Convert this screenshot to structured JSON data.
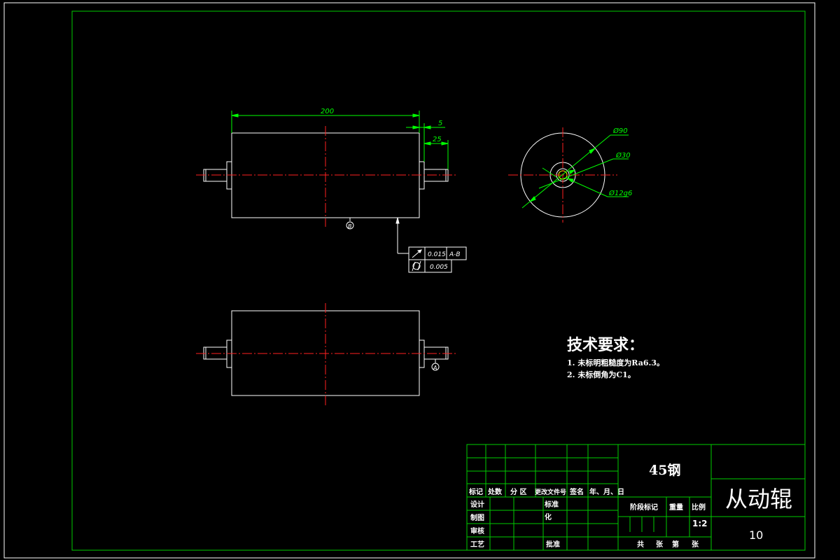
{
  "drawing": {
    "dimensions": {
      "overall_length": "200",
      "right_offset": "5",
      "shaft_length": "25",
      "outer_diameter": "Ø90",
      "mid_diameter": "Ø30",
      "shaft_diameter": "Ø12g6"
    },
    "datums": {
      "b": "B",
      "a": "A"
    },
    "tolerance": {
      "row1_value": "0.015",
      "row1_datum": "A-B",
      "row2_value": "0.005"
    }
  },
  "tech_requirements": {
    "title": "技术要求：",
    "item1": "1. 未标明粗糙度为Ra6.3。",
    "item2": "2. 未标倒角为C1。"
  },
  "title_block": {
    "material": "45钢",
    "part_name": "从动辊",
    "sheet_number": "10",
    "headers": {
      "mark": "标记",
      "count": "处数",
      "zone": "分 区",
      "change_doc": "更改文件号",
      "signature": "签名",
      "date": "年、月、日"
    },
    "rows": {
      "design": "设计",
      "standardize_1": "标准",
      "standardize_2": "化",
      "draw": "制图",
      "review": "审核",
      "process": "工艺",
      "approve": "批准"
    },
    "stage_mark": "阶段标记",
    "weight": "重量",
    "ratio": "比例",
    "scale": "1:2",
    "sheets_total": "共",
    "sheets_label": "张",
    "sheet_no_label": "第",
    "sheet_label2": "张"
  }
}
